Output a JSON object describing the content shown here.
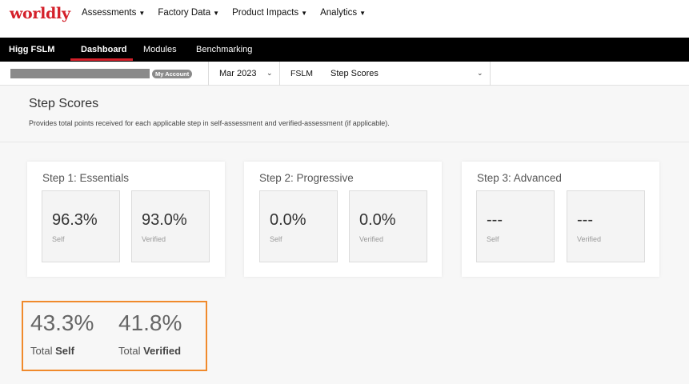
{
  "brand": {
    "logo": "worldly"
  },
  "top_nav": [
    {
      "label": "Assessments"
    },
    {
      "label": "Factory Data"
    },
    {
      "label": "Product Impacts"
    },
    {
      "label": "Analytics"
    }
  ],
  "sub_nav": {
    "brand": "Higg FSLM",
    "tabs": [
      {
        "label": "Dashboard",
        "active": true
      },
      {
        "label": "Modules",
        "active": false
      },
      {
        "label": "Benchmarking",
        "active": false
      }
    ]
  },
  "selector_bar": {
    "account_badge": "My Account",
    "date": "Mar 2023",
    "module": "FSLM",
    "view": "Step Scores"
  },
  "page": {
    "title": "Step Scores",
    "description": "Provides total points received for each applicable step in self-assessment and verified-assessment (if applicable)."
  },
  "steps": [
    {
      "title": "Step 1: Essentials",
      "self": "96.3%",
      "verified": "93.0%",
      "self_label": "Self",
      "verified_label": "Verified"
    },
    {
      "title": "Step 2: Progressive",
      "self": "0.0%",
      "verified": "0.0%",
      "self_label": "Self",
      "verified_label": "Verified"
    },
    {
      "title": "Step 3: Advanced",
      "self": "---",
      "verified": "---",
      "self_label": "Self",
      "verified_label": "Verified"
    }
  ],
  "totals": {
    "self_value": "43.3%",
    "self_prefix": "Total",
    "self_label": "Self",
    "verified_value": "41.8%",
    "verified_prefix": "Total",
    "verified_label": "Verified"
  },
  "colors": {
    "brand_red": "#d4202a",
    "highlight_orange": "#f08a2c"
  }
}
